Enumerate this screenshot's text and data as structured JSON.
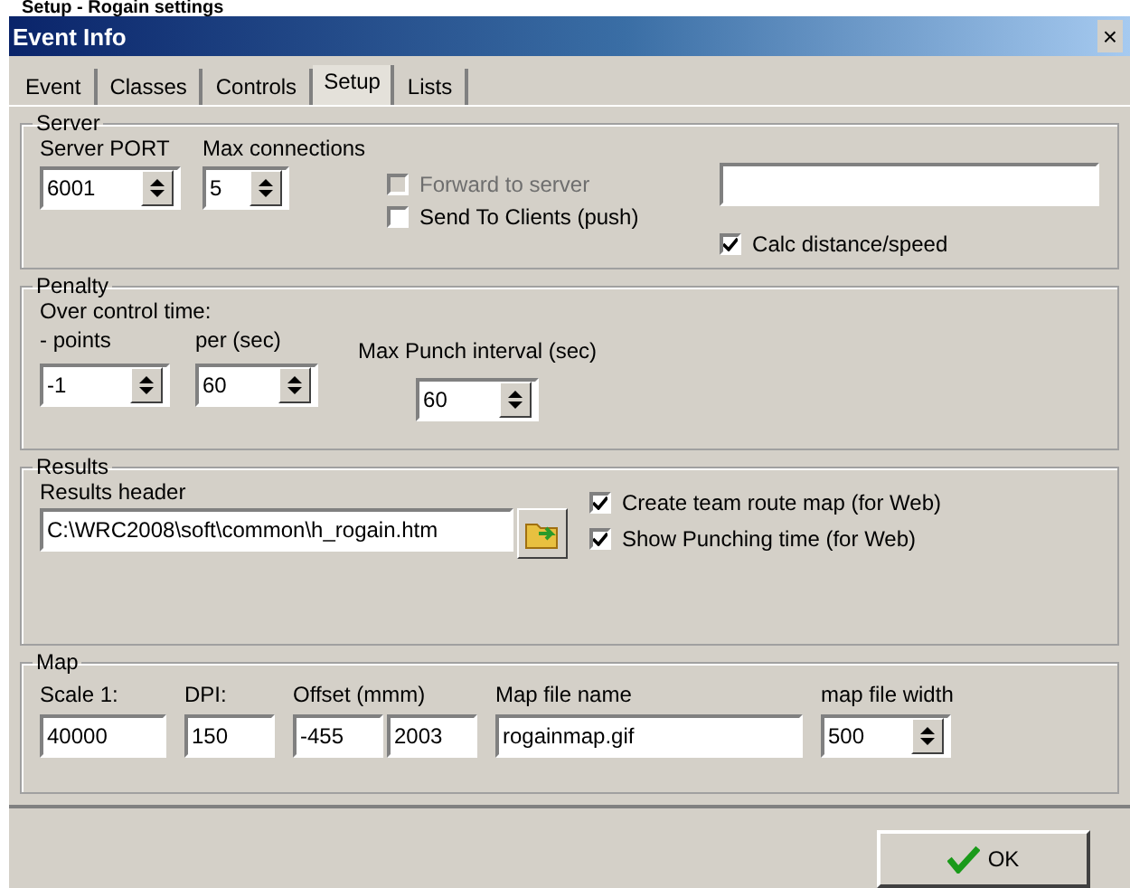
{
  "heading": "Setup - Rogain settings",
  "window": {
    "title": "Event Info",
    "close": "×"
  },
  "tabs": [
    {
      "label": "Event",
      "selected": false
    },
    {
      "label": "Classes",
      "selected": false
    },
    {
      "label": "Controls",
      "selected": false
    },
    {
      "label": "Setup",
      "selected": true
    },
    {
      "label": "Lists",
      "selected": false
    }
  ],
  "server": {
    "title": "Server",
    "port": {
      "label": "Server PORT",
      "value": "6001"
    },
    "max_connections": {
      "label": "Max connections",
      "value": "5"
    },
    "options": [
      {
        "label": "Forward to server",
        "checked": false,
        "disabled": true
      },
      {
        "label": "Send To Clients (push)",
        "checked": false,
        "disabled": false
      }
    ],
    "calc": {
      "label": "Calc distance/speed",
      "checked": true,
      "disabled": false
    }
  },
  "penalty": {
    "title": "Penalty",
    "over_label": "Over control time:",
    "points": {
      "label": "- points",
      "value": "-1"
    },
    "per": {
      "label": "per (sec)",
      "value": "60"
    },
    "max_punch": {
      "label": "Max Punch interval (sec)",
      "value": "60"
    }
  },
  "results": {
    "title": "Results",
    "header_label": "Results header",
    "header_value": "C:\\WRC2008\\soft\\common\\h_rogain.htm",
    "options": [
      {
        "label": "Create team route map (for Web)",
        "checked": true,
        "disabled": false
      },
      {
        "label": "Show Punching time  (for Web)",
        "checked": true,
        "disabled": false
      }
    ]
  },
  "map": {
    "title": "Map",
    "fields": [
      {
        "kind": "text",
        "label": "Scale 1:",
        "values": [
          "40000"
        ]
      },
      {
        "kind": "text",
        "label": "DPI:",
        "values": [
          "150"
        ]
      },
      {
        "kind": "pair",
        "label": "Offset (mmm)",
        "values": [
          "-455",
          "2003"
        ]
      },
      {
        "kind": "wide",
        "label": "Map file name",
        "values": [
          "rogainmap.gif"
        ]
      },
      {
        "kind": "spin",
        "label": "map file width",
        "values": [
          "500"
        ]
      }
    ]
  },
  "ok_button": "OK"
}
